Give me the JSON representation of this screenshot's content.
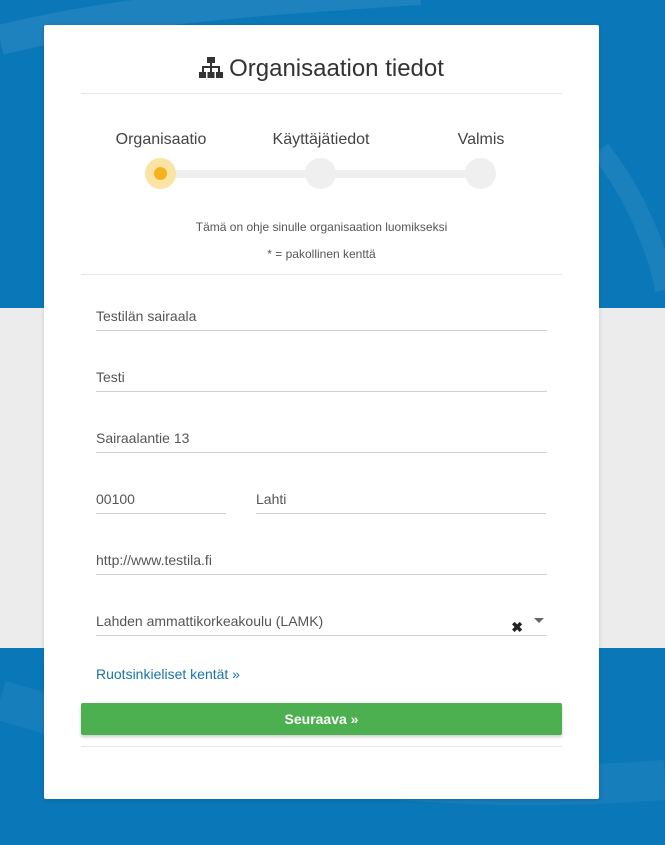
{
  "page": {
    "title": "Organisaation tiedot",
    "title_icon": "sitemap-icon"
  },
  "steps": [
    {
      "label": "Organisaatio",
      "active": true
    },
    {
      "label": "Käyttäjätiedot",
      "active": false
    },
    {
      "label": "Valmis",
      "active": false
    }
  ],
  "hints": {
    "instructions": "Tämä on ohje sinulle organisaation luomikseksi",
    "required_note": "* = pakollinen kenttä"
  },
  "form": {
    "organization_name": "Testilän sairaala",
    "short_name": "Testi",
    "street_address": "Sairaalantie 13",
    "postal_code": "00100",
    "city": "Lahti",
    "website": "http://www.testila.fi",
    "parent_organization": "Lahden ammattikorkeakoulu (LAMK)"
  },
  "links": {
    "swedish_fields": "Ruotsinkieliset kentät »"
  },
  "buttons": {
    "next": "Seuraava »"
  },
  "colors": {
    "background_blue": "#0a78b8",
    "active_step": "#f5b21c",
    "primary_button": "#4caf50",
    "link": "#1a73a8"
  }
}
